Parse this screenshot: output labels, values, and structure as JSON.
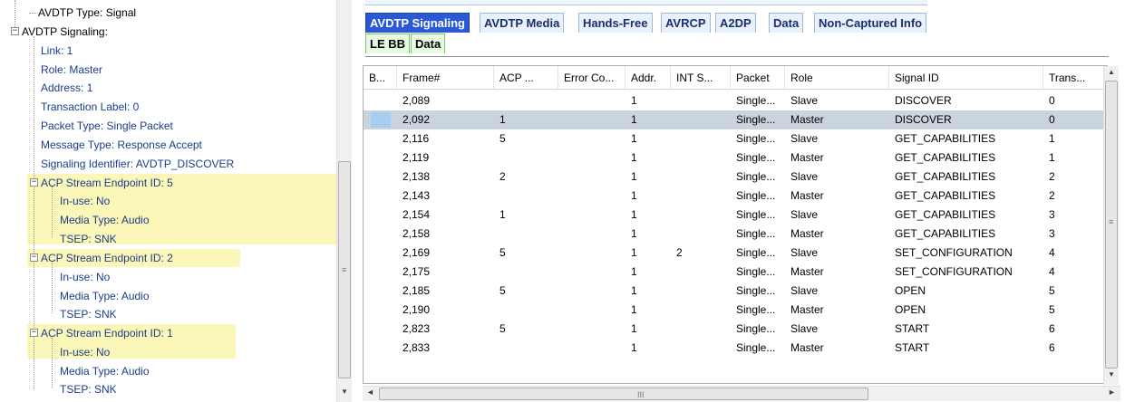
{
  "tree": {
    "nodes": [
      "AVDTP Type: Signal",
      "AVDTP Signaling:",
      "Link: 1",
      "Role: Master",
      "Address: 1",
      "Transaction Label: 0",
      "Packet Type: Single Packet",
      "Message Type: Response Accept",
      "Signaling Identifier: AVDTP_DISCOVER",
      "ACP Stream Endpoint ID: 5",
      "In-use: No",
      "Media Type: Audio",
      "TSEP: SNK",
      "ACP Stream Endpoint ID: 2",
      "In-use: No",
      "Media Type: Audio",
      "TSEP: SNK",
      "ACP Stream Endpoint ID: 1",
      "In-use: No",
      "Media Type: Audio",
      "TSEP: SNK"
    ],
    "expander_minus": "−"
  },
  "tabs": {
    "row1": [
      "AVDTP Signaling",
      "AVDTP Media",
      "Hands-Free",
      "AVRCP",
      "A2DP",
      "Data",
      "Non-Captured Info"
    ],
    "row2": [
      "LE BB",
      "Data"
    ],
    "separator": "|"
  },
  "grid": {
    "columns": [
      "B...",
      "Frame#",
      "ACP ...",
      "Error Co...",
      "Addr.",
      "INT S...",
      "Packet",
      "Role",
      "Signal ID",
      "Trans..."
    ],
    "rows": [
      [
        "",
        "2,089",
        "",
        "",
        "1",
        "",
        "Single...",
        "Slave",
        "DISCOVER",
        "0"
      ],
      [
        "",
        "2,092",
        "1",
        "",
        "1",
        "",
        "Single...",
        "Master",
        "DISCOVER",
        "0"
      ],
      [
        "",
        "2,116",
        "5",
        "",
        "1",
        "",
        "Single...",
        "Slave",
        "GET_CAPABILITIES",
        "1"
      ],
      [
        "",
        "2,119",
        "",
        "",
        "1",
        "",
        "Single...",
        "Master",
        "GET_CAPABILITIES",
        "1"
      ],
      [
        "",
        "2,138",
        "2",
        "",
        "1",
        "",
        "Single...",
        "Slave",
        "GET_CAPABILITIES",
        "2"
      ],
      [
        "",
        "2,143",
        "",
        "",
        "1",
        "",
        "Single...",
        "Master",
        "GET_CAPABILITIES",
        "2"
      ],
      [
        "",
        "2,154",
        "1",
        "",
        "1",
        "",
        "Single...",
        "Slave",
        "GET_CAPABILITIES",
        "3"
      ],
      [
        "",
        "2,158",
        "",
        "",
        "1",
        "",
        "Single...",
        "Master",
        "GET_CAPABILITIES",
        "3"
      ],
      [
        "",
        "2,169",
        "5",
        "",
        "1",
        "2",
        "Single...",
        "Slave",
        "SET_CONFIGURATION",
        "4"
      ],
      [
        "",
        "2,175",
        "",
        "",
        "1",
        "",
        "Single...",
        "Master",
        "SET_CONFIGURATION",
        "4"
      ],
      [
        "",
        "2,185",
        "5",
        "",
        "1",
        "",
        "Single...",
        "Slave",
        "OPEN",
        "5"
      ],
      [
        "",
        "2,190",
        "",
        "",
        "1",
        "",
        "Single...",
        "Master",
        "OPEN",
        "5"
      ],
      [
        "",
        "2,823",
        "5",
        "",
        "1",
        "",
        "Single...",
        "Slave",
        "START",
        "6"
      ],
      [
        "",
        "2,833",
        "",
        "",
        "1",
        "",
        "Single...",
        "Master",
        "START",
        "6"
      ]
    ]
  },
  "scroll": {
    "up": "▲",
    "down": "▼",
    "left": "◄",
    "right": "►",
    "grip_v": "≡",
    "grip_h": "III"
  },
  "colors": {
    "active_tab": "#2b59d6",
    "selected_row": "#c9d4df",
    "row_marker": "#a7cdf1",
    "highlight": "#fbf7b8",
    "green_tab": "#e7f9e0"
  }
}
